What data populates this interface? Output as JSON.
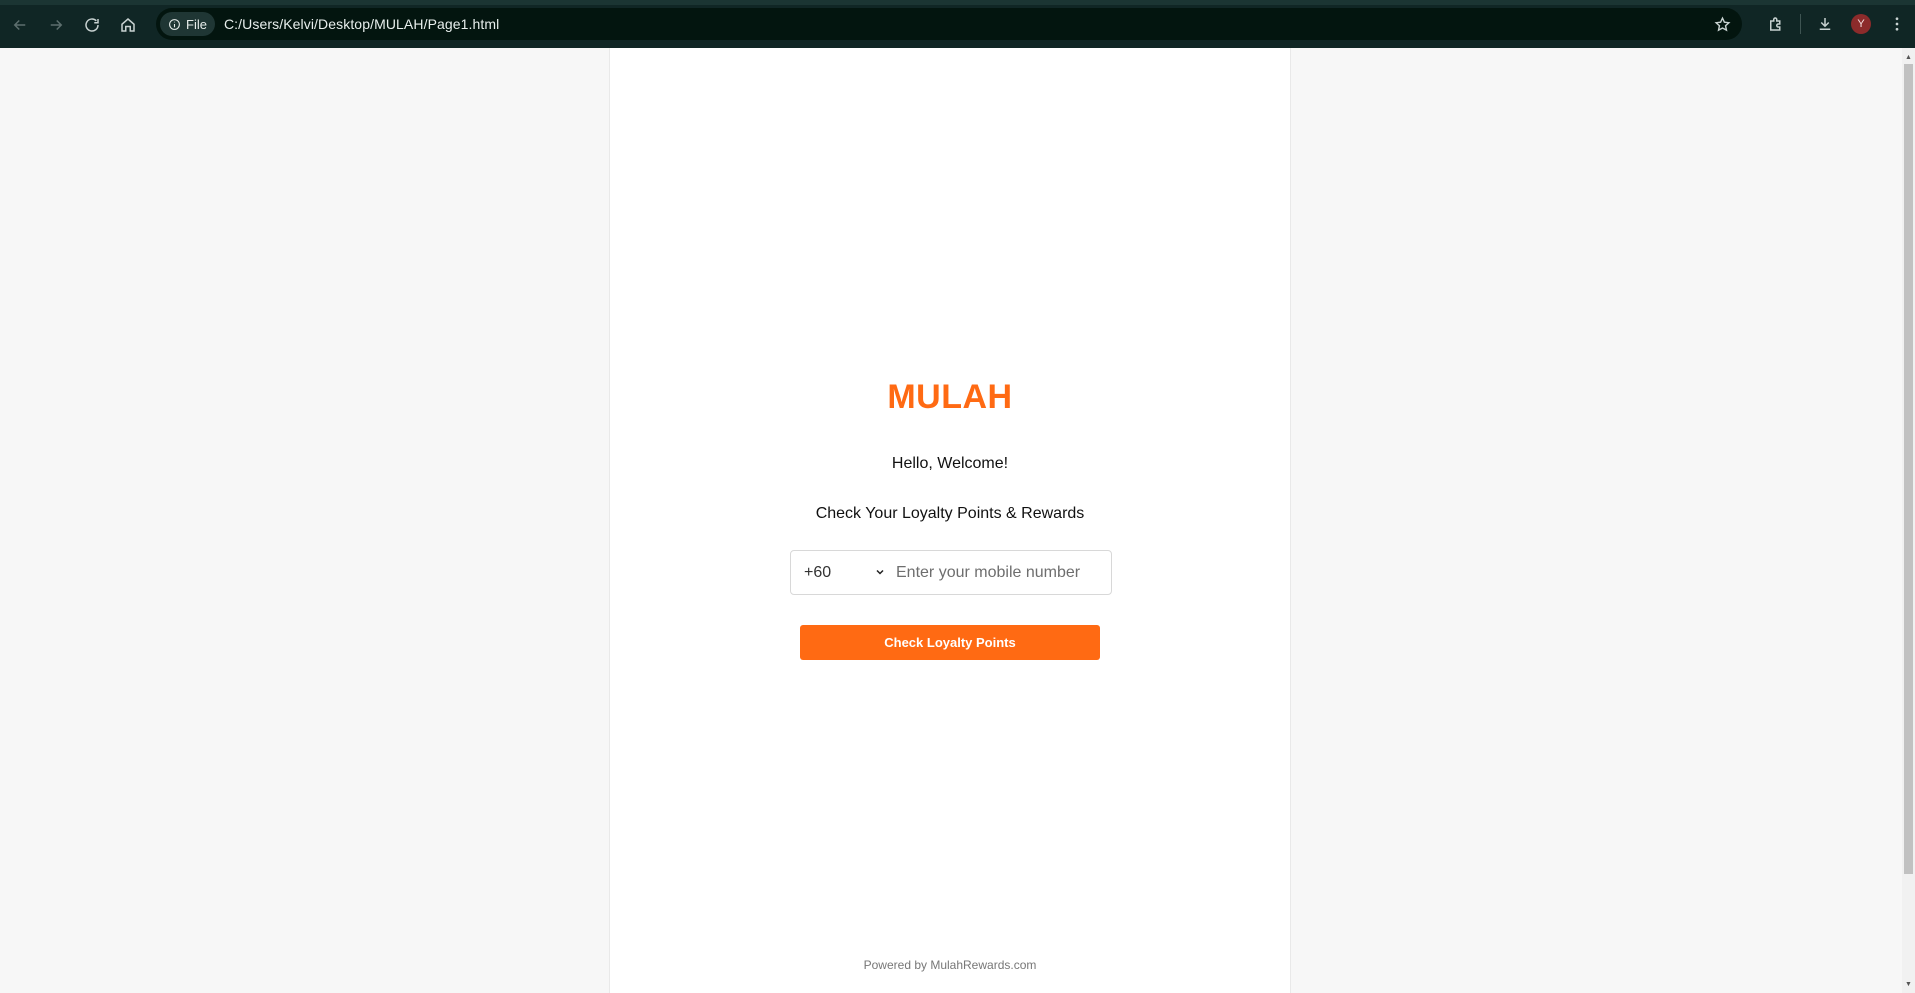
{
  "browser": {
    "site_chip_label": "File",
    "url": "C:/Users/Kelvi/Desktop/MULAH/Page1.html",
    "profile_initial": "Y",
    "icons": {
      "back": "arrow-left-icon",
      "forward": "arrow-right-icon",
      "reload": "reload-icon",
      "home": "home-icon",
      "site_info": "info-icon",
      "bookmark": "star-icon",
      "extensions": "puzzle-icon",
      "downloads": "download-icon",
      "menu": "kebab-menu-icon"
    }
  },
  "page": {
    "brand": "MULAH",
    "welcome": "Hello, Welcome!",
    "subtitle": "Check Your Loyalty Points & Rewards",
    "country_code": "+60",
    "mobile_placeholder": "Enter your mobile number",
    "check_button_label": "Check Loyalty Points",
    "footer": "Powered by MulahRewards.com"
  },
  "colors": {
    "brand": "#ff6a13",
    "browser_bar": "#102625",
    "page_bg": "#f7f7f7",
    "card_bg": "#ffffff"
  }
}
